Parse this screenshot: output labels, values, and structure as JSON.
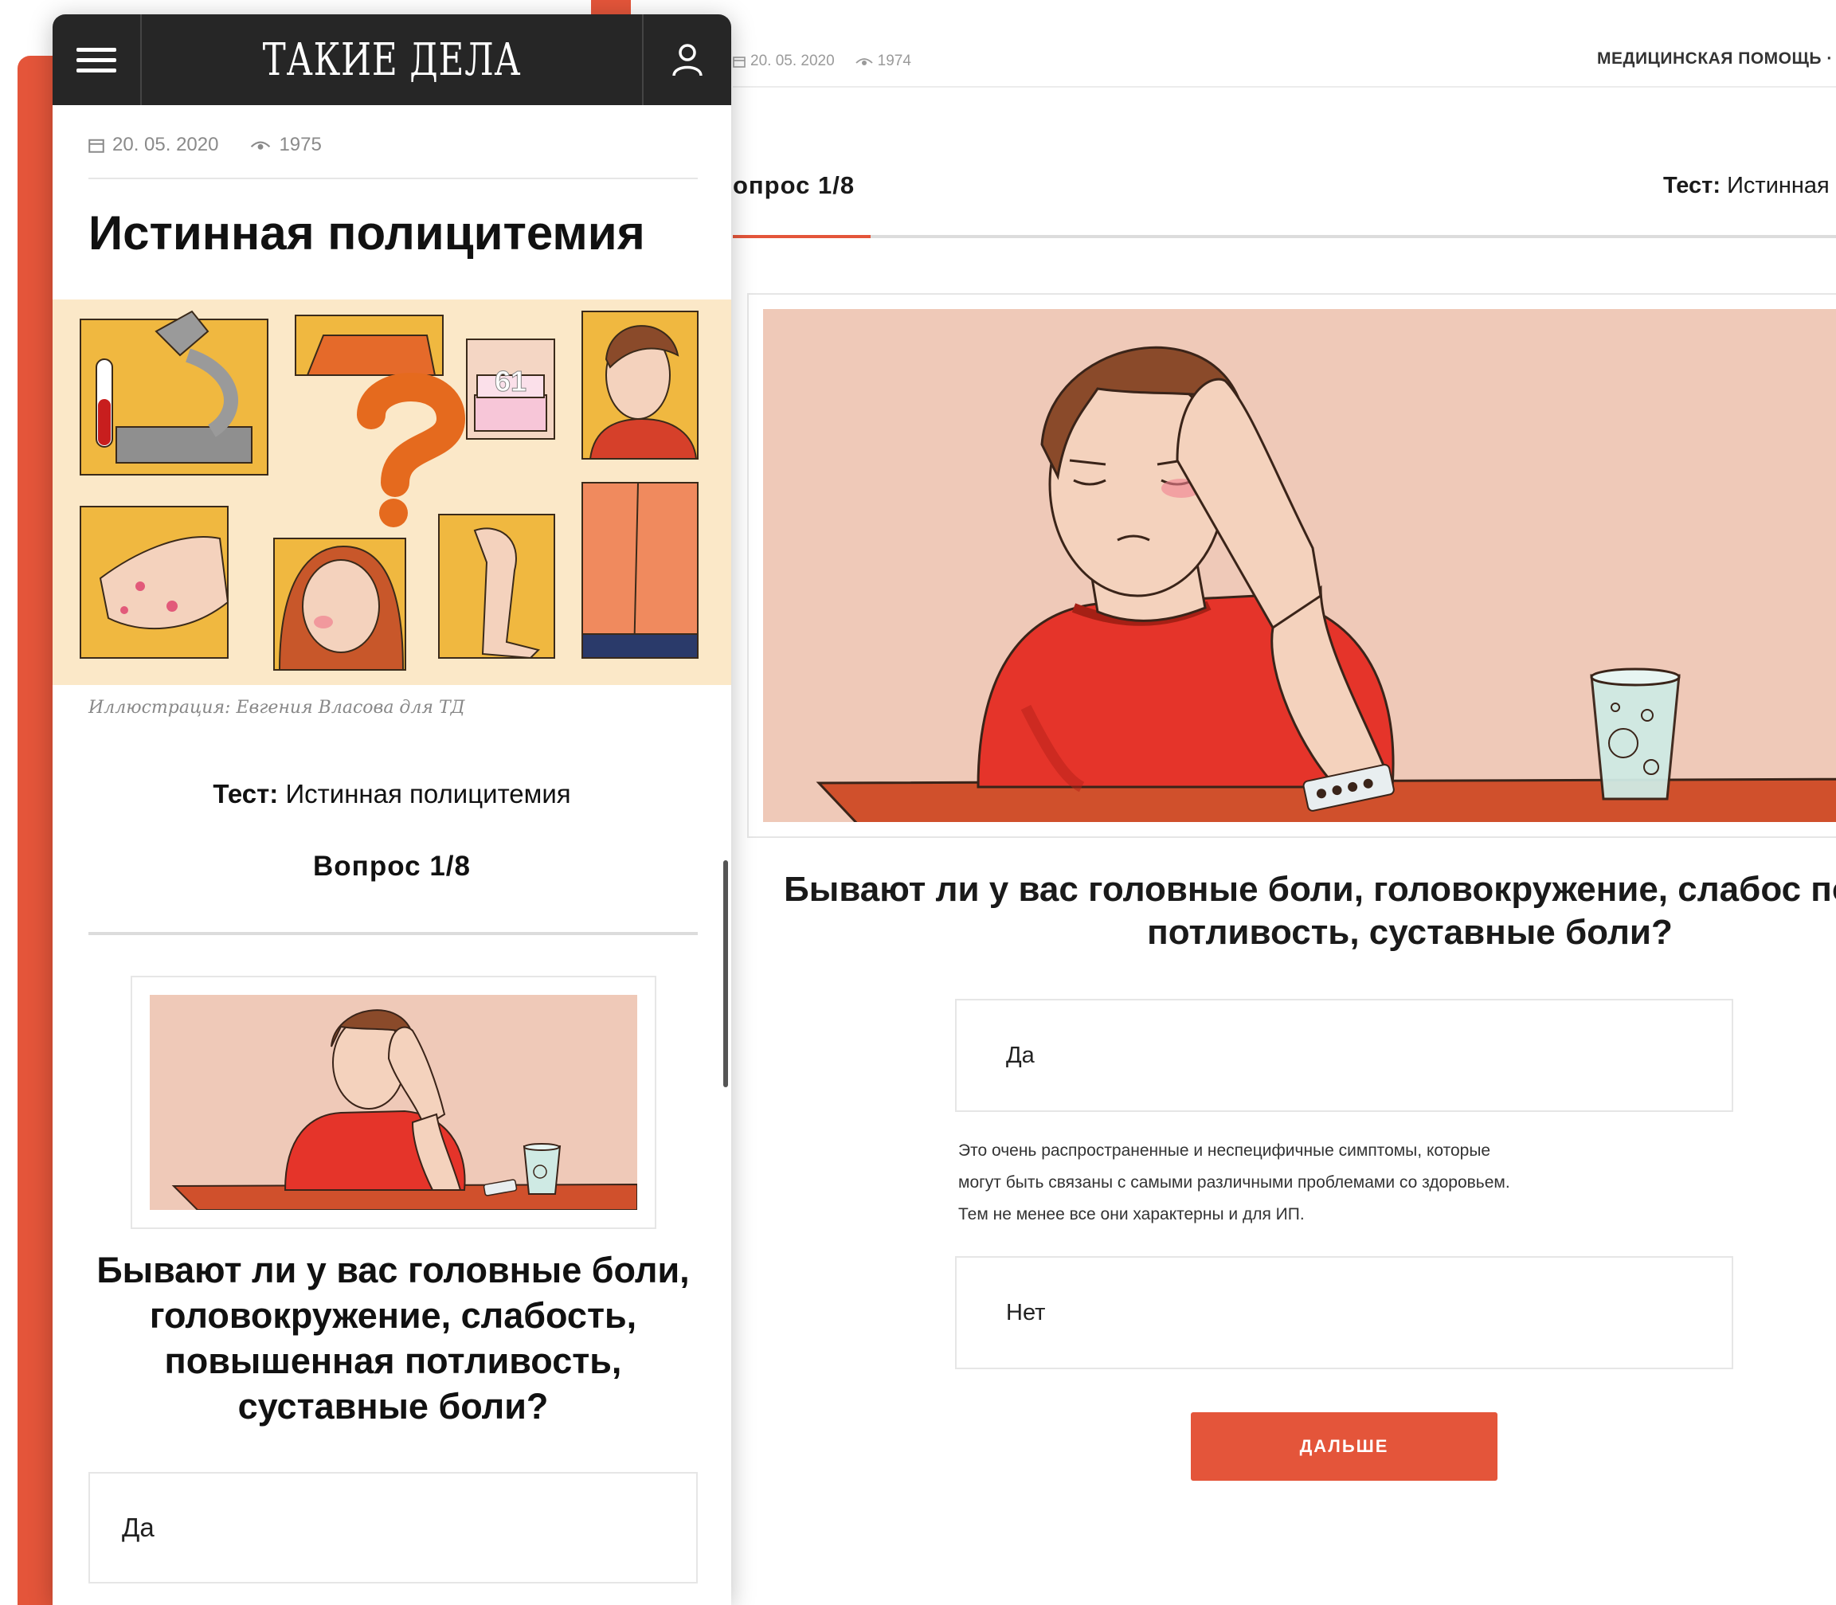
{
  "brand": {
    "logo_text": "ТАКИЕ ДЕЛА",
    "accent_color": "#e4553a",
    "header_color": "#262626"
  },
  "desktop": {
    "meta": {
      "date": "20. 05. 2020",
      "views": "1974"
    },
    "category": "МЕДИЦИНСКАЯ ПОМОЩЬ ·",
    "question_count": "опрос 1/8",
    "test_title_prefix": "Тест:",
    "test_title_text": "Истинная п",
    "progress_fraction": 0.125,
    "question_text": "Бывают ли у вас головные боли, головокружение, слабос повышенная потливость, суставные боли?",
    "options": [
      "Да",
      "Нет"
    ],
    "feedback_lines": [
      "Это очень распространенные и неспецифичные симптомы, которые",
      "могут быть связаны с самыми различными проблемами со здоровьем.",
      "Тем не менее все они характерны и для ИП."
    ],
    "next_button": "ДАЛЬШЕ"
  },
  "mobile": {
    "meta": {
      "date": "20. 05. 2020",
      "views": "1975"
    },
    "title": "Истинная полицитемия",
    "cake_number": "61",
    "caption": "Иллюстрация: Евгения Власова для ТД",
    "test_title_prefix": "Тест:",
    "test_title_text": "Истинная полицитемия",
    "question_count": "Вопрос 1/8",
    "question_text": "Бывают ли у вас головные боли, головокружение, слабость, повышенная потливость, суставные боли?",
    "first_option": "Да"
  },
  "icons": [
    "menu-icon",
    "user-icon",
    "calendar-icon",
    "eye-icon"
  ]
}
